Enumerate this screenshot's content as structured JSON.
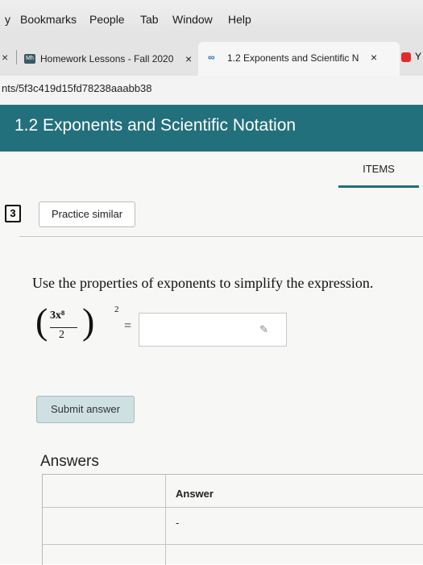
{
  "menubar": {
    "items": [
      "y",
      "Bookmarks",
      "People",
      "Tab",
      "Window",
      "Help"
    ]
  },
  "tabs": {
    "close_left": "×",
    "homework_tab": {
      "title": "Homework Lessons - Fall 2020",
      "favicon_text": "Mh",
      "close": "×"
    },
    "exponents_tab": {
      "title": "1.2 Exponents and Scientific N",
      "close": "×"
    },
    "right_edge_letter": "Y"
  },
  "url": {
    "text": "nts/5f3c419d15fd78238aaabb38"
  },
  "banner": {
    "title": "1.2 Exponents and Scientific Notation"
  },
  "items_tab": {
    "label": "ITEMS"
  },
  "question": {
    "number": "3",
    "practice_label": "Practice similar",
    "prompt": "Use the properties of exponents to simplify the expression.",
    "numerator": "3x⁸",
    "denominator": "2",
    "exponent": "2",
    "equals": "=",
    "answer_value": ""
  },
  "submit": {
    "label": "Submit answer"
  },
  "answers": {
    "title": "Answers",
    "column_header": "Answer",
    "rows": [
      "",
      "-"
    ]
  },
  "colors": {
    "banner": "#22707c",
    "submit_bg": "#cfe0e2"
  }
}
